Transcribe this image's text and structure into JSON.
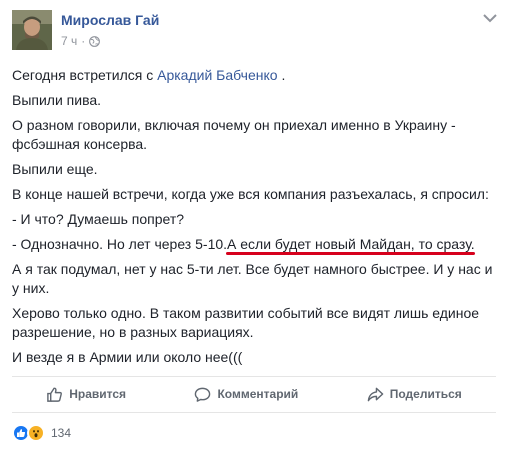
{
  "post": {
    "author": "Мирослав Гай",
    "time": "7 ч",
    "meta_separator": "·",
    "privacy_icon": "globe-icon",
    "menu_icon": "chevron-down-icon",
    "mention": "Аркадий Бабченко",
    "line1_before": "Сегодня встретился с",
    "line1_after": ".",
    "p2": "Выпили пива.",
    "p3": "О разном говорили, включая почему он приехал именно в Украину - фсбэшная консерва.",
    "p4": "Выпили еще.",
    "p5": "В конце нашей встречи, когда уже вся компания разъехалась, я спросил:",
    "p6": "- И что? Думаешь попрет?",
    "p7_before": "- Однозначно. Но лет через 5-10.",
    "p7_underlined": "А если будет новый Майдан, то сразу.",
    "p8": "А я так подумал, нет у нас 5-ти лет. Все будет намного быстрее. И у нас и у них.",
    "p9": "Херово только одно. В таком развитии событий все видят лишь единое разрешение, но в разных вариациях.",
    "p10": "И везде я в Армии или около нее(((",
    "highlight_color": "#d6001c"
  },
  "actions": {
    "like": "Нравится",
    "comment": "Комментарий",
    "share": "Поделиться",
    "like_icon": "thumbs-up-icon",
    "comment_icon": "speech-bubble-icon",
    "share_icon": "share-arrow-icon"
  },
  "reactions": {
    "count": "134",
    "types": [
      "like-icon",
      "wow-icon"
    ]
  },
  "colors": {
    "link": "#365899",
    "text": "#1d2129",
    "muted": "#90949c",
    "like": "#1877f2",
    "wow": "#f7b125"
  }
}
